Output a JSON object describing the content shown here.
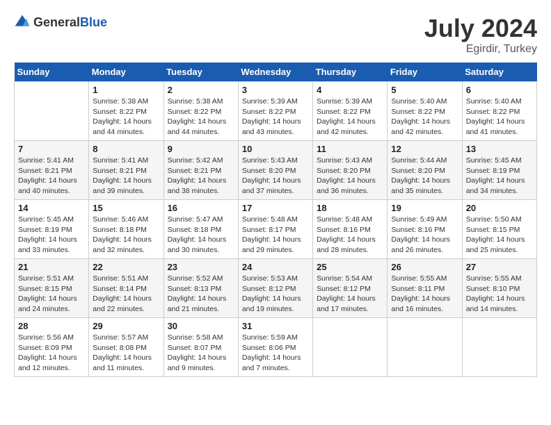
{
  "header": {
    "logo_general": "General",
    "logo_blue": "Blue",
    "month_year": "July 2024",
    "location": "Egirdir, Turkey"
  },
  "days_of_week": [
    "Sunday",
    "Monday",
    "Tuesday",
    "Wednesday",
    "Thursday",
    "Friday",
    "Saturday"
  ],
  "weeks": [
    [
      {
        "day": "",
        "sunrise": "",
        "sunset": "",
        "daylight": ""
      },
      {
        "day": "1",
        "sunrise": "Sunrise: 5:38 AM",
        "sunset": "Sunset: 8:22 PM",
        "daylight": "Daylight: 14 hours and 44 minutes."
      },
      {
        "day": "2",
        "sunrise": "Sunrise: 5:38 AM",
        "sunset": "Sunset: 8:22 PM",
        "daylight": "Daylight: 14 hours and 44 minutes."
      },
      {
        "day": "3",
        "sunrise": "Sunrise: 5:39 AM",
        "sunset": "Sunset: 8:22 PM",
        "daylight": "Daylight: 14 hours and 43 minutes."
      },
      {
        "day": "4",
        "sunrise": "Sunrise: 5:39 AM",
        "sunset": "Sunset: 8:22 PM",
        "daylight": "Daylight: 14 hours and 42 minutes."
      },
      {
        "day": "5",
        "sunrise": "Sunrise: 5:40 AM",
        "sunset": "Sunset: 8:22 PM",
        "daylight": "Daylight: 14 hours and 42 minutes."
      },
      {
        "day": "6",
        "sunrise": "Sunrise: 5:40 AM",
        "sunset": "Sunset: 8:22 PM",
        "daylight": "Daylight: 14 hours and 41 minutes."
      }
    ],
    [
      {
        "day": "7",
        "sunrise": "Sunrise: 5:41 AM",
        "sunset": "Sunset: 8:21 PM",
        "daylight": "Daylight: 14 hours and 40 minutes."
      },
      {
        "day": "8",
        "sunrise": "Sunrise: 5:41 AM",
        "sunset": "Sunset: 8:21 PM",
        "daylight": "Daylight: 14 hours and 39 minutes."
      },
      {
        "day": "9",
        "sunrise": "Sunrise: 5:42 AM",
        "sunset": "Sunset: 8:21 PM",
        "daylight": "Daylight: 14 hours and 38 minutes."
      },
      {
        "day": "10",
        "sunrise": "Sunrise: 5:43 AM",
        "sunset": "Sunset: 8:20 PM",
        "daylight": "Daylight: 14 hours and 37 minutes."
      },
      {
        "day": "11",
        "sunrise": "Sunrise: 5:43 AM",
        "sunset": "Sunset: 8:20 PM",
        "daylight": "Daylight: 14 hours and 36 minutes."
      },
      {
        "day": "12",
        "sunrise": "Sunrise: 5:44 AM",
        "sunset": "Sunset: 8:20 PM",
        "daylight": "Daylight: 14 hours and 35 minutes."
      },
      {
        "day": "13",
        "sunrise": "Sunrise: 5:45 AM",
        "sunset": "Sunset: 8:19 PM",
        "daylight": "Daylight: 14 hours and 34 minutes."
      }
    ],
    [
      {
        "day": "14",
        "sunrise": "Sunrise: 5:45 AM",
        "sunset": "Sunset: 8:19 PM",
        "daylight": "Daylight: 14 hours and 33 minutes."
      },
      {
        "day": "15",
        "sunrise": "Sunrise: 5:46 AM",
        "sunset": "Sunset: 8:18 PM",
        "daylight": "Daylight: 14 hours and 32 minutes."
      },
      {
        "day": "16",
        "sunrise": "Sunrise: 5:47 AM",
        "sunset": "Sunset: 8:18 PM",
        "daylight": "Daylight: 14 hours and 30 minutes."
      },
      {
        "day": "17",
        "sunrise": "Sunrise: 5:48 AM",
        "sunset": "Sunset: 8:17 PM",
        "daylight": "Daylight: 14 hours and 29 minutes."
      },
      {
        "day": "18",
        "sunrise": "Sunrise: 5:48 AM",
        "sunset": "Sunset: 8:16 PM",
        "daylight": "Daylight: 14 hours and 28 minutes."
      },
      {
        "day": "19",
        "sunrise": "Sunrise: 5:49 AM",
        "sunset": "Sunset: 8:16 PM",
        "daylight": "Daylight: 14 hours and 26 minutes."
      },
      {
        "day": "20",
        "sunrise": "Sunrise: 5:50 AM",
        "sunset": "Sunset: 8:15 PM",
        "daylight": "Daylight: 14 hours and 25 minutes."
      }
    ],
    [
      {
        "day": "21",
        "sunrise": "Sunrise: 5:51 AM",
        "sunset": "Sunset: 8:15 PM",
        "daylight": "Daylight: 14 hours and 24 minutes."
      },
      {
        "day": "22",
        "sunrise": "Sunrise: 5:51 AM",
        "sunset": "Sunset: 8:14 PM",
        "daylight": "Daylight: 14 hours and 22 minutes."
      },
      {
        "day": "23",
        "sunrise": "Sunrise: 5:52 AM",
        "sunset": "Sunset: 8:13 PM",
        "daylight": "Daylight: 14 hours and 21 minutes."
      },
      {
        "day": "24",
        "sunrise": "Sunrise: 5:53 AM",
        "sunset": "Sunset: 8:12 PM",
        "daylight": "Daylight: 14 hours and 19 minutes."
      },
      {
        "day": "25",
        "sunrise": "Sunrise: 5:54 AM",
        "sunset": "Sunset: 8:12 PM",
        "daylight": "Daylight: 14 hours and 17 minutes."
      },
      {
        "day": "26",
        "sunrise": "Sunrise: 5:55 AM",
        "sunset": "Sunset: 8:11 PM",
        "daylight": "Daylight: 14 hours and 16 minutes."
      },
      {
        "day": "27",
        "sunrise": "Sunrise: 5:55 AM",
        "sunset": "Sunset: 8:10 PM",
        "daylight": "Daylight: 14 hours and 14 minutes."
      }
    ],
    [
      {
        "day": "28",
        "sunrise": "Sunrise: 5:56 AM",
        "sunset": "Sunset: 8:09 PM",
        "daylight": "Daylight: 14 hours and 12 minutes."
      },
      {
        "day": "29",
        "sunrise": "Sunrise: 5:57 AM",
        "sunset": "Sunset: 8:08 PM",
        "daylight": "Daylight: 14 hours and 11 minutes."
      },
      {
        "day": "30",
        "sunrise": "Sunrise: 5:58 AM",
        "sunset": "Sunset: 8:07 PM",
        "daylight": "Daylight: 14 hours and 9 minutes."
      },
      {
        "day": "31",
        "sunrise": "Sunrise: 5:59 AM",
        "sunset": "Sunset: 8:06 PM",
        "daylight": "Daylight: 14 hours and 7 minutes."
      },
      {
        "day": "",
        "sunrise": "",
        "sunset": "",
        "daylight": ""
      },
      {
        "day": "",
        "sunrise": "",
        "sunset": "",
        "daylight": ""
      },
      {
        "day": "",
        "sunrise": "",
        "sunset": "",
        "daylight": ""
      }
    ]
  ]
}
